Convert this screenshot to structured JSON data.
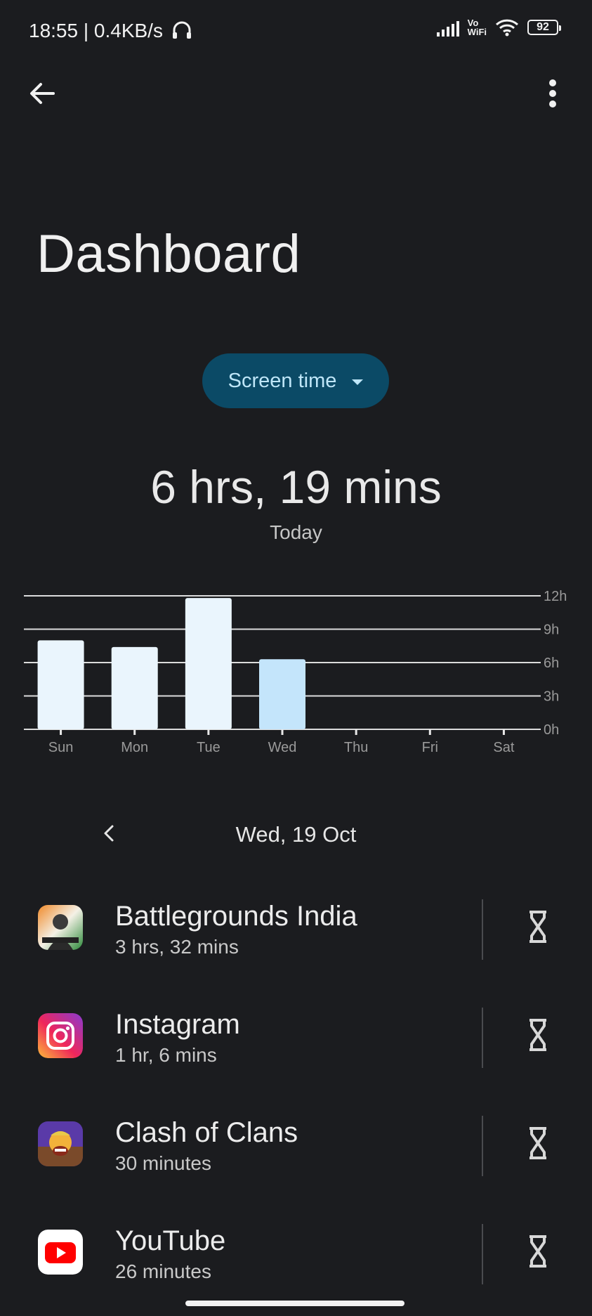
{
  "status_bar": {
    "time": "18:55 | 0.4KB/s",
    "network_label": "Vo\nWiFi",
    "battery": "92",
    "icons": [
      "headphones-icon",
      "signal-icon",
      "wifi-icon",
      "battery-icon"
    ]
  },
  "toolbar": {
    "back_icon": "arrow-left-icon",
    "menu_icon": "more-vert-icon"
  },
  "page": {
    "title": "Dashboard",
    "metric_selector": "Screen time",
    "total": "6 hrs, 19 mins",
    "total_caption": "Today",
    "date": "Wed, 19 Oct"
  },
  "colors": {
    "background": "#1b1c1f",
    "chip_bg": "#0b4a66",
    "chip_text": "#bfe6f8",
    "bar": "#eaf5fd",
    "bar_selected": "#c4e5fb"
  },
  "chart_data": {
    "type": "bar",
    "categories": [
      "Sun",
      "Mon",
      "Tue",
      "Wed",
      "Thu",
      "Fri",
      "Sat"
    ],
    "values": [
      8,
      7.4,
      11.8,
      6.3,
      0,
      0,
      0
    ],
    "selected_index": 3,
    "y_ticks": [
      "0h",
      "3h",
      "6h",
      "9h",
      "12h"
    ],
    "ylim": [
      0,
      12
    ],
    "grid": true,
    "y_axis_side": "right"
  },
  "apps": [
    {
      "name": "Battlegrounds India",
      "time": "3 hrs, 32 mins",
      "icon": "battlegrounds-icon"
    },
    {
      "name": "Instagram",
      "time": "1 hr, 6 mins",
      "icon": "instagram-icon"
    },
    {
      "name": "Clash of Clans",
      "time": "30 minutes",
      "icon": "clash-of-clans-icon"
    },
    {
      "name": "YouTube",
      "time": "26 minutes",
      "icon": "youtube-icon"
    }
  ]
}
